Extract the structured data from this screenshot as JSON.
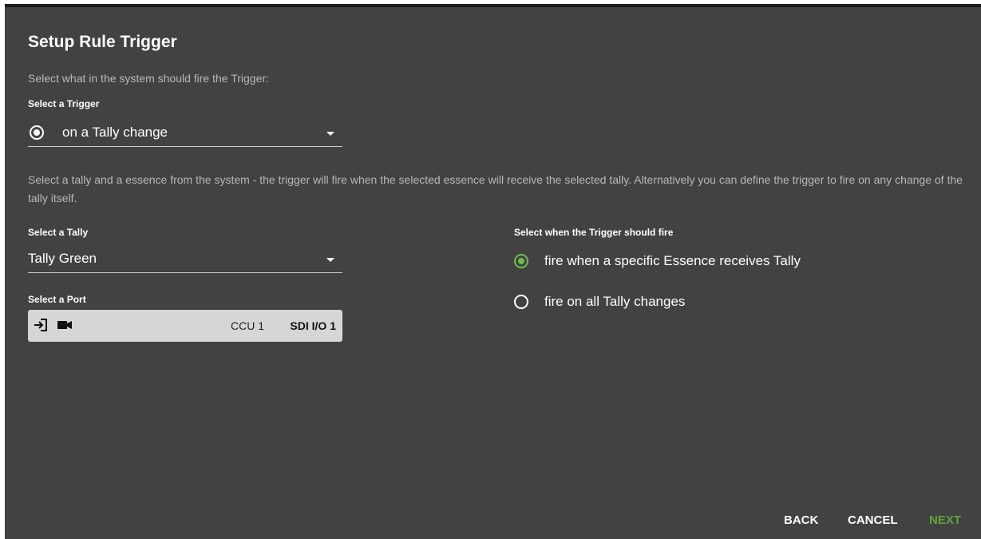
{
  "dialog": {
    "title": "Setup Rule Trigger",
    "subtitle": "Select what in the system should fire the Trigger:"
  },
  "trigger": {
    "label": "Select a Trigger",
    "value": "on a Tally change",
    "icon": "radio-target-icon"
  },
  "description": "Select a tally and a essence from the system - the trigger will fire when the selected essence will receive the selected tally. Alternatively you can define the trigger to fire on any change of the tally itself.",
  "tally": {
    "label": "Select a Tally",
    "value": "Tally Green"
  },
  "port": {
    "label": "Select a Port",
    "device": "CCU 1",
    "io": "SDI I/O 1",
    "icons": [
      "input-icon",
      "camera-icon"
    ]
  },
  "fire_mode": {
    "label": "Select when the Trigger should fire",
    "options": [
      {
        "label": "fire when a specific Essence receives Tally",
        "selected": true
      },
      {
        "label": "fire on all Tally changes",
        "selected": false
      }
    ],
    "accent": "#6cc04a"
  },
  "actions": {
    "back": "BACK",
    "cancel": "CANCEL",
    "next": "NEXT",
    "next_color": "#5fa63b"
  }
}
